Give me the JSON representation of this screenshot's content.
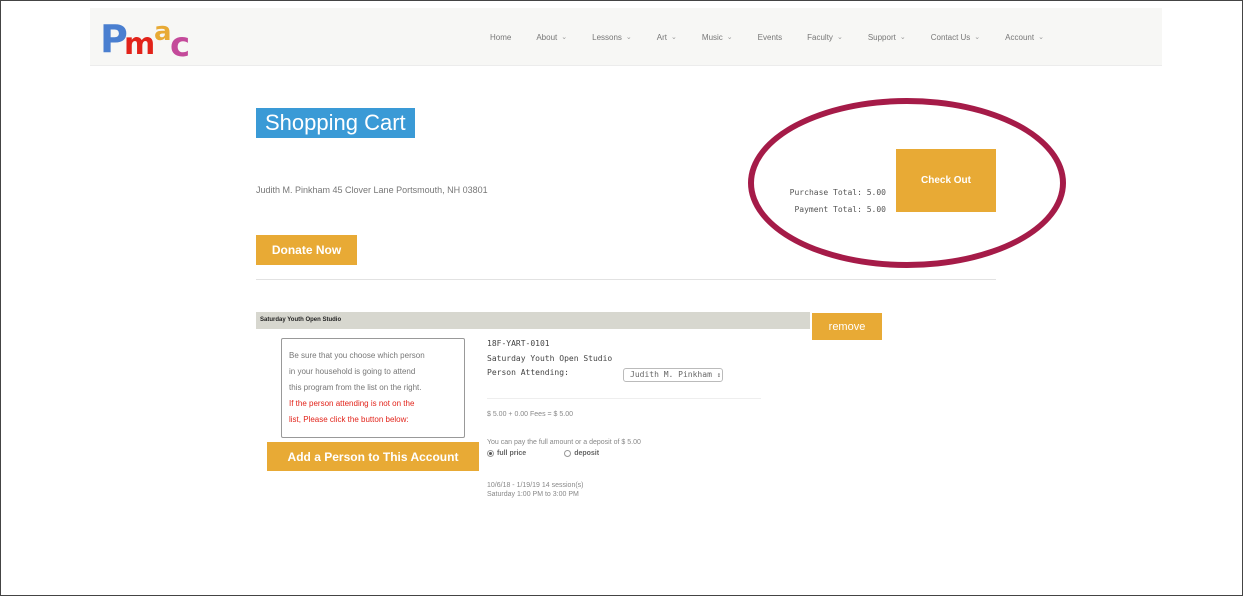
{
  "brand": {
    "colors": {
      "accent": "#e8aa35",
      "title_bg": "#3a9ad6",
      "highlight": "#a51b48",
      "warning": "#e2231a"
    }
  },
  "nav": {
    "items": [
      {
        "label": "Home",
        "dropdown": false
      },
      {
        "label": "About",
        "dropdown": true
      },
      {
        "label": "Lessons",
        "dropdown": true
      },
      {
        "label": "Art",
        "dropdown": true
      },
      {
        "label": "Music",
        "dropdown": true
      },
      {
        "label": "Events",
        "dropdown": false
      },
      {
        "label": "Faculty",
        "dropdown": true
      },
      {
        "label": "Support",
        "dropdown": true
      },
      {
        "label": "Contact Us",
        "dropdown": true
      },
      {
        "label": "Account",
        "dropdown": true
      }
    ]
  },
  "page": {
    "title": "Shopping Cart",
    "address": "Judith M. Pinkham  45 Clover Lane Portsmouth, NH 03801",
    "purchase_total": "Purchase Total: 5.00",
    "payment_total": "Payment Total: 5.00",
    "checkout_label": "Check Out",
    "donate_label": "Donate Now"
  },
  "item": {
    "bar_title": "Saturday Youth Open Studio",
    "remove_label": "remove",
    "notice_lines": [
      "Be sure that you choose which person",
      "in your household is going to attend",
      "this program from the list on the right."
    ],
    "notice_red_lines": [
      "If the person attending is not on the",
      "list, Please click the button below:"
    ],
    "add_person_label": "Add a Person to This Account",
    "code": "18F-YART-0101",
    "name": "Saturday Youth Open Studio",
    "person_label": "Person Attending:",
    "person_selected": "Judith M. Pinkham",
    "fees": "$ 5.00 + 0.00 Fees = $ 5.00",
    "pay_option_text": "You can pay the full amount or a deposit of $ 5.00",
    "radio_full": "full price",
    "radio_deposit": "deposit",
    "schedule_line1": "10/6/18 - 1/19/19 14 session(s)",
    "schedule_line2": "Saturday 1:00 PM to 3:00 PM"
  },
  "icons": {
    "chevron": "chevron-down-icon",
    "select_arrows": "select-arrows-icon"
  }
}
